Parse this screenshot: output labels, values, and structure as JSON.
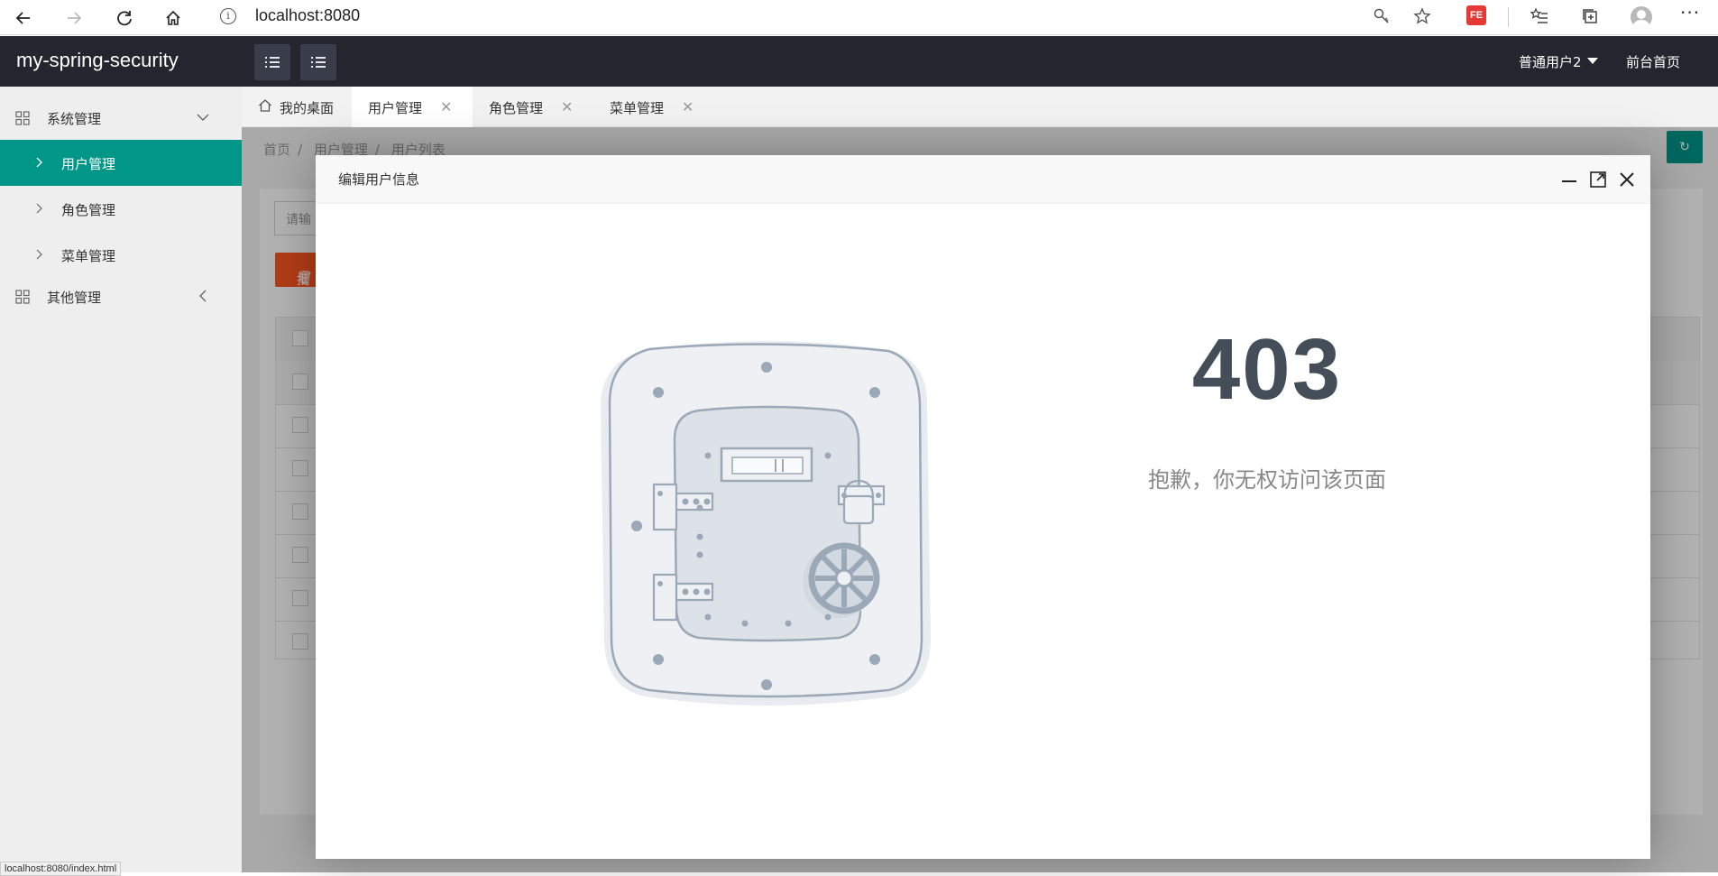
{
  "browser": {
    "url": "localhost:8080",
    "status_url": "localhost:8080/index.html"
  },
  "header": {
    "logo": "my-spring-security",
    "user_name": "普通用户2",
    "front_link": "前台首页"
  },
  "sidebar": {
    "groups": [
      {
        "label": "系统管理",
        "expanded": true
      },
      {
        "label": "其他管理",
        "expanded": false
      }
    ],
    "items": [
      {
        "label": "用户管理",
        "active": true
      },
      {
        "label": "角色管理",
        "active": false
      },
      {
        "label": "菜单管理",
        "active": false
      }
    ]
  },
  "tabs": [
    {
      "label": "我的桌面",
      "icon": "home-icon"
    },
    {
      "label": "用户管理",
      "active": true
    },
    {
      "label": "角色管理"
    },
    {
      "label": "菜单管理"
    }
  ],
  "breadcrumb": [
    "首页",
    "用户管理",
    "用户列表"
  ],
  "content": {
    "search_placeholder": "请输",
    "batch_delete_label": "批"
  },
  "modal": {
    "title": "编辑用户信息",
    "error_code": "403",
    "error_message": "抱歉，你无权访问该页面"
  },
  "colors": {
    "header_bg": "#23262e",
    "active_menu": "#009688",
    "danger_btn": "#ff5722",
    "error_code": "#434e59"
  }
}
